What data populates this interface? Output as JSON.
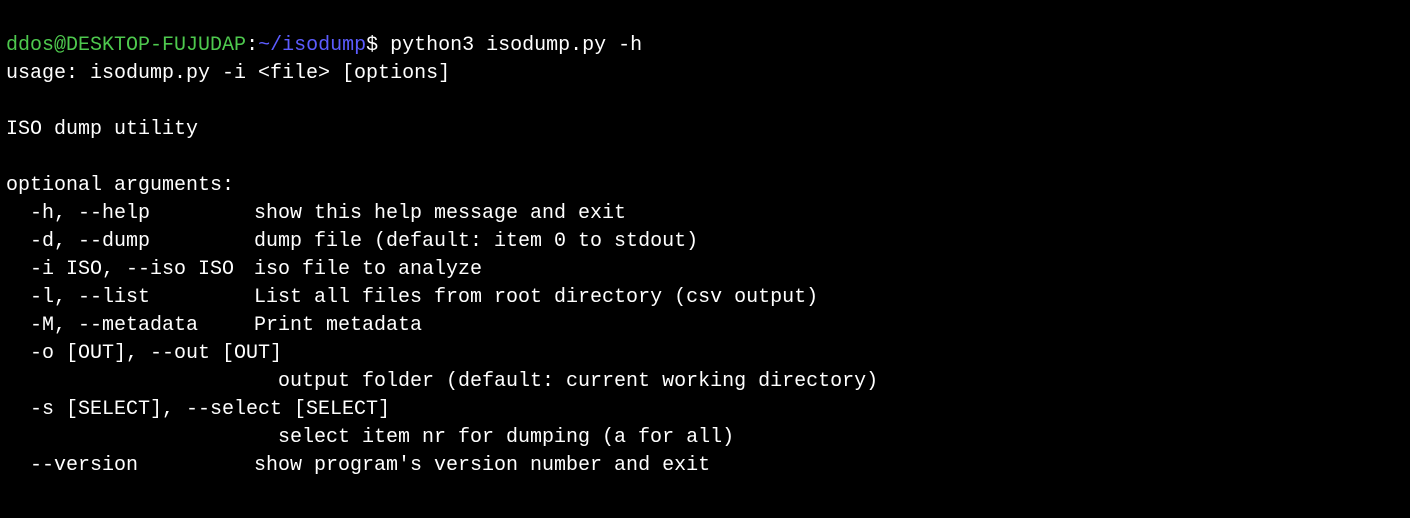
{
  "prompt": {
    "user": "ddos",
    "at": "@",
    "host": "DESKTOP-FUJUDAP",
    "colon": ":",
    "path": "~/isodump",
    "symbol": "$",
    "command": "python3 isodump.py -h"
  },
  "output": {
    "usage": "usage: isodump.py -i <file> [options]",
    "blank1": "",
    "description": "ISO dump utility",
    "blank2": "",
    "section_header": "optional arguments:",
    "args": [
      {
        "flag": "-h, --help",
        "desc": "show this help message and exit",
        "wrap": false
      },
      {
        "flag": "-d, --dump",
        "desc": "dump file (default: item 0 to stdout)",
        "wrap": false
      },
      {
        "flag": "-i ISO, --iso ISO",
        "desc": "iso file to analyze",
        "wrap": false
      },
      {
        "flag": "-l, --list",
        "desc": "List all files from root directory (csv output)",
        "wrap": false
      },
      {
        "flag": "-M, --metadata",
        "desc": "Print metadata",
        "wrap": false
      },
      {
        "flag": "-o [OUT], --out [OUT]",
        "desc": "output folder (default: current working directory)",
        "wrap": true
      },
      {
        "flag": "-s [SELECT], --select [SELECT]",
        "desc": "select item nr for dumping (a for all)",
        "wrap": true
      },
      {
        "flag": "--version",
        "desc": "show program's version number and exit",
        "wrap": false
      }
    ]
  }
}
